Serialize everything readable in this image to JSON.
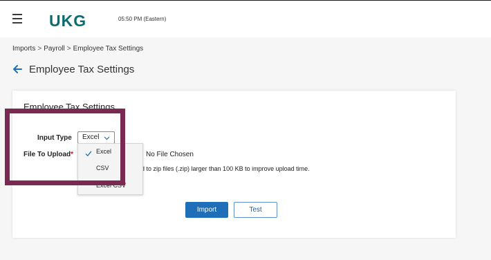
{
  "header": {
    "logo_text": "UKG",
    "time": "05:50 PM (Eastern)",
    "colors": {
      "logo": "#0c6b6e",
      "primary_button": "#1f6fb8",
      "highlight_box": "#7a2950"
    }
  },
  "breadcrumb": {
    "items": [
      "Imports",
      "Payroll",
      "Employee Tax Settings"
    ],
    "separator": ">"
  },
  "page": {
    "title": "Employee Tax Settings"
  },
  "card": {
    "title": "Employee Tax Settings",
    "input_type_label": "Input Type",
    "input_type_value": "Excel",
    "file_label": "File To Upload",
    "required_mark": "*",
    "no_file_text": "No File Chosen",
    "hint_text": "ded to zip files (.zip) larger than 100 KB to improve upload time.",
    "dropdown": {
      "options": [
        "Excel",
        "CSV",
        "Excel CSV"
      ],
      "selected": "Excel"
    },
    "import_button": "Import",
    "test_button": "Test"
  }
}
